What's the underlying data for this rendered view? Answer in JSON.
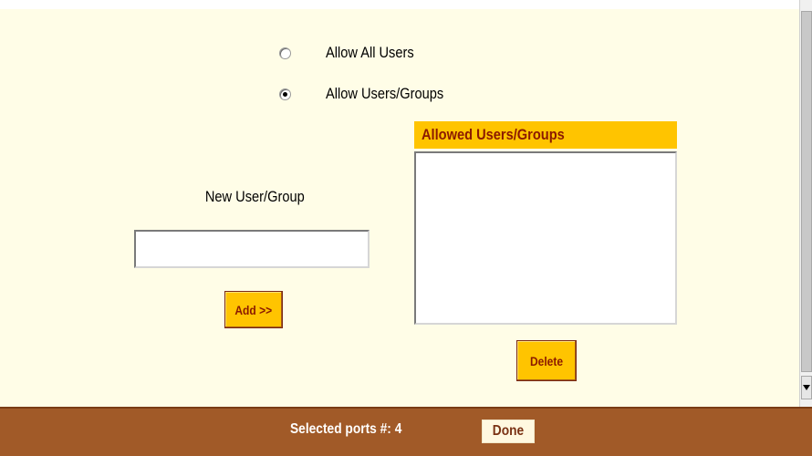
{
  "access": {
    "options": [
      {
        "label": "Allow All Users",
        "checked": false
      },
      {
        "label": "Allow Users/Groups",
        "checked": true
      }
    ]
  },
  "new_user": {
    "label": "New User/Group",
    "value": "",
    "add_label": "Add >>"
  },
  "allowed": {
    "header": "Allowed Users/Groups",
    "items": [],
    "delete_label": "Delete"
  },
  "footer": {
    "status": "Selected ports #: 4",
    "done_label": "Done"
  },
  "colors": {
    "page_background": "#fffde7",
    "button_background": "#ffc400",
    "button_text": "#8b1a00",
    "footer_background": "#a15a28"
  },
  "icons": {
    "scroll_down": "triangle-down-icon"
  }
}
